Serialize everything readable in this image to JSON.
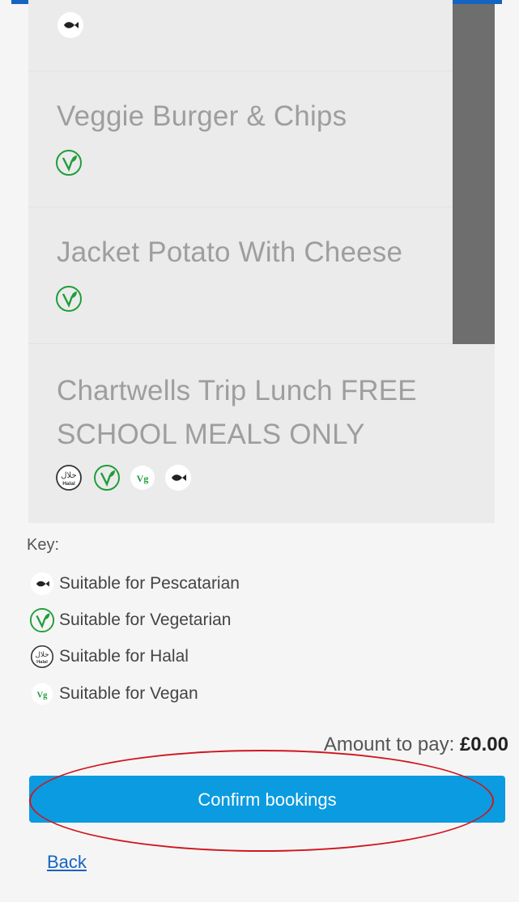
{
  "menu_items": [
    {
      "name": "",
      "icons": [
        "fish-icon"
      ]
    },
    {
      "name": "Veggie Burger & Chips",
      "icons": [
        "vegetarian-icon"
      ]
    },
    {
      "name": "Jacket Potato With Cheese",
      "icons": [
        "vegetarian-icon"
      ]
    },
    {
      "name_line1": "Chartwells Trip Lunch FREE",
      "name_line2": "SCHOOL MEALS ONLY",
      "icons": [
        "halal-icon",
        "vegetarian-icon",
        "vegan-icon",
        "fish-icon"
      ]
    }
  ],
  "key": {
    "title": "Key:",
    "items": [
      {
        "icon": "fish-icon",
        "label": "Suitable for Pescatarian"
      },
      {
        "icon": "vegetarian-icon",
        "label": "Suitable for Vegetarian"
      },
      {
        "icon": "halal-icon",
        "label": "Suitable for Halal"
      },
      {
        "icon": "vegan-icon",
        "label": "Suitable for Vegan"
      }
    ]
  },
  "payment": {
    "amount_label": "Amount to pay:",
    "amount_value": "£0.00"
  },
  "actions": {
    "confirm_label": "Confirm bookings",
    "back_label": "Back"
  },
  "icon_text": {
    "vegan": "Vg",
    "halal_top": "حلال",
    "halal_bottom": "Halal"
  },
  "colors": {
    "accent_blue": "#0b9be0",
    "link_blue": "#1565c0",
    "veg_green": "#1f9d3a",
    "annotation_red": "#d0161e"
  }
}
